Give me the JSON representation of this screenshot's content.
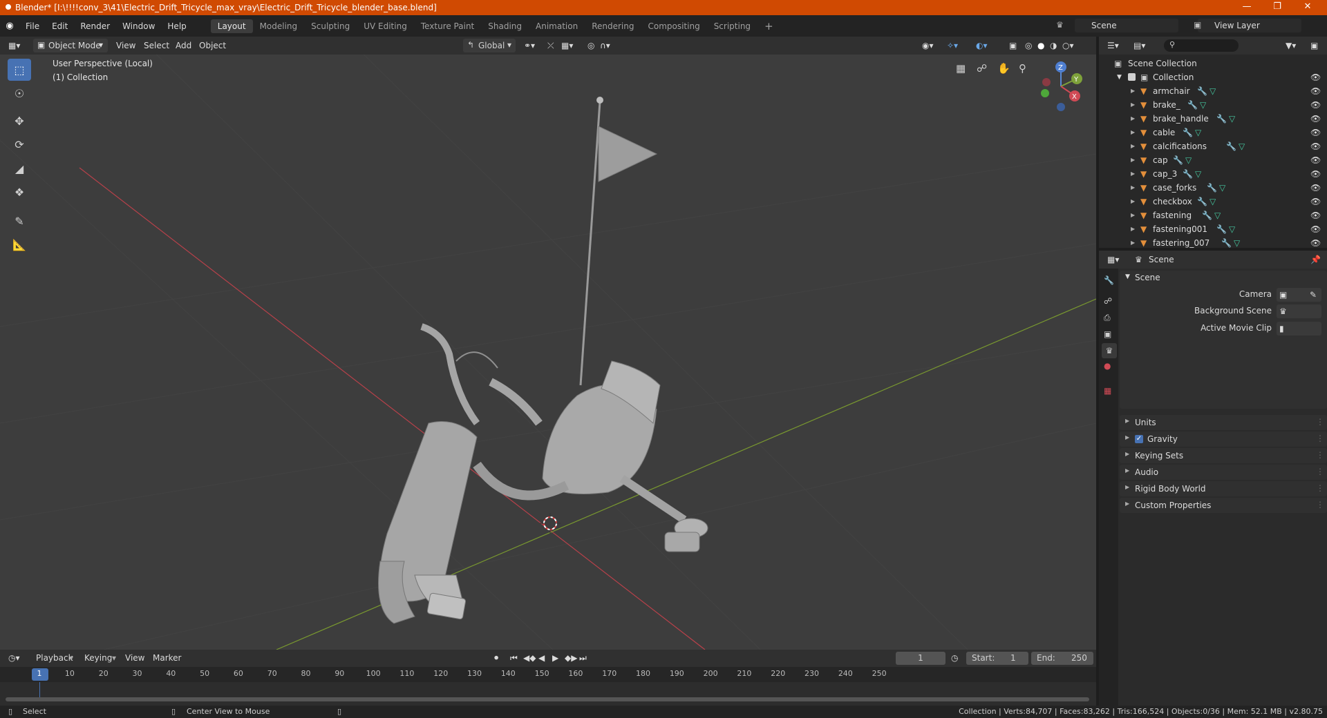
{
  "window": {
    "title": "Blender* [I:\\!!!!conv_3\\41\\Electric_Drift_Tricycle_max_vray\\Electric_Drift_Tricycle_blender_base.blend]"
  },
  "menu": [
    "File",
    "Edit",
    "Render",
    "Window",
    "Help"
  ],
  "workspaces": [
    "Layout",
    "Modeling",
    "Sculpting",
    "UV Editing",
    "Texture Paint",
    "Shading",
    "Animation",
    "Rendering",
    "Compositing",
    "Scripting"
  ],
  "scene_field": "Scene",
  "view_layer_field": "View Layer",
  "viewport_header": {
    "mode": "Object Mode",
    "menus": [
      "View",
      "Select",
      "Add",
      "Object"
    ],
    "orientation": "Global"
  },
  "viewport_overlay": {
    "line1": "User Perspective (Local)",
    "line2": "(1) Collection"
  },
  "gizmo": {
    "x": "X",
    "y": "Y",
    "z": "Z"
  },
  "outliner": {
    "root": "Scene Collection",
    "collection": "Collection",
    "items": [
      "armchair",
      "brake_",
      "brake_handle",
      "cable",
      "calcifications",
      "cap",
      "cap_3",
      "case_forks",
      "checkbox",
      "fastening",
      "fastening001",
      "fastering_007"
    ]
  },
  "properties": {
    "header": "Scene",
    "panel_title": "Scene",
    "camera_label": "Camera",
    "background_scene_label": "Background Scene",
    "active_movie_clip_label": "Active Movie Clip",
    "sections": [
      "Units",
      "Gravity",
      "Keying Sets",
      "Audio",
      "Rigid Body World",
      "Custom Properties"
    ]
  },
  "timeline": {
    "menus": [
      "Playback",
      "Keying",
      "View",
      "Marker"
    ],
    "current_frame": "1",
    "start_label": "Start:",
    "start_value": "1",
    "end_label": "End:",
    "end_value": "250",
    "ticks": [
      "1",
      "10",
      "20",
      "30",
      "40",
      "50",
      "60",
      "70",
      "80",
      "90",
      "100",
      "110",
      "120",
      "130",
      "140",
      "150",
      "160",
      "170",
      "180",
      "190",
      "200",
      "210",
      "220",
      "230",
      "240",
      "250"
    ]
  },
  "status": {
    "select": "Select",
    "center": "Center View to Mouse",
    "stats": "Collection | Verts:84,707 | Faces:83,262 | Tris:166,524 | Objects:0/36 | Mem: 52.1 MB | v2.80.75"
  },
  "colors": {
    "accent": "#4772b3",
    "titlebar": "#d04a02",
    "object_orange": "#e38f3b",
    "mesh_green": "#45c9a1"
  }
}
